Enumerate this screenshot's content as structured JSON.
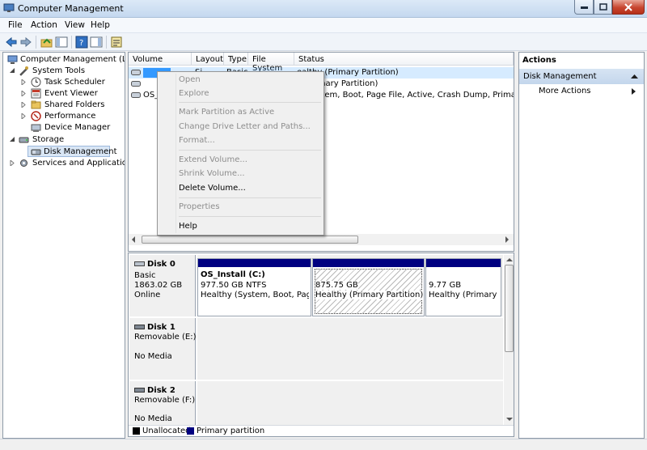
{
  "window": {
    "title": "Computer Management"
  },
  "menu": [
    "File",
    "Action",
    "View",
    "Help"
  ],
  "tree": {
    "items": [
      {
        "label": "Computer Management (Local"
      },
      {
        "label": "System Tools"
      },
      {
        "label": "Task Scheduler"
      },
      {
        "label": "Event Viewer"
      },
      {
        "label": "Shared Folders"
      },
      {
        "label": "Performance"
      },
      {
        "label": "Device Manager"
      },
      {
        "label": "Storage"
      },
      {
        "label": "Disk Management"
      },
      {
        "label": "Services and Applications"
      }
    ]
  },
  "volume_list": {
    "columns": [
      "Volume",
      "Layout",
      "Type",
      "File System",
      "Status"
    ],
    "rows": [
      {
        "volume": "",
        "layout": "Si",
        "type": "Basic",
        "fs": "",
        "status": "ealthy (Primary Partition)"
      },
      {
        "volume": "",
        "layout": "",
        "type": "",
        "fs": "",
        "status": "y (Primary Partition)"
      },
      {
        "volume": "OS_",
        "layout": "",
        "type": "",
        "fs": "",
        "status": "y (System, Boot, Page File, Active, Crash Dump, Primary P"
      }
    ]
  },
  "context_menu": {
    "items": [
      {
        "label": "Open",
        "enabled": false
      },
      {
        "label": "Explore",
        "enabled": false
      },
      {
        "label": "Mark Partition as Active",
        "enabled": false
      },
      {
        "label": "Change Drive Letter and Paths...",
        "enabled": false
      },
      {
        "label": "Format...",
        "enabled": false
      },
      {
        "label": "Extend Volume...",
        "enabled": false
      },
      {
        "label": "Shrink Volume...",
        "enabled": false
      },
      {
        "label": "Delete Volume...",
        "enabled": true
      },
      {
        "label": "Properties",
        "enabled": false
      },
      {
        "label": "Help",
        "enabled": true
      }
    ]
  },
  "disks": [
    {
      "name": "Disk 0",
      "type": "Basic",
      "size": "1863.02 GB",
      "state": "Online",
      "partitions": [
        {
          "title": "OS_Install  (C:)",
          "size": "977.50 GB NTFS",
          "status": "Healthy (System, Boot, Page Fi"
        },
        {
          "title": "",
          "size": "875.75 GB",
          "status": "Healthy (Primary Partition)"
        },
        {
          "title": "",
          "size": "9.77 GB",
          "status": "Healthy (Primary Pa"
        }
      ]
    },
    {
      "name": "Disk 1",
      "type": "Removable (E:)",
      "state": "No Media"
    },
    {
      "name": "Disk 2",
      "type": "Removable (F:)",
      "state": "No Media"
    }
  ],
  "legend": [
    {
      "label": "Unallocated",
      "color": "#000000"
    },
    {
      "label": "Primary partition",
      "color": "#000080"
    }
  ],
  "actions": {
    "header": "Actions",
    "section": "Disk Management",
    "more": "More Actions"
  }
}
